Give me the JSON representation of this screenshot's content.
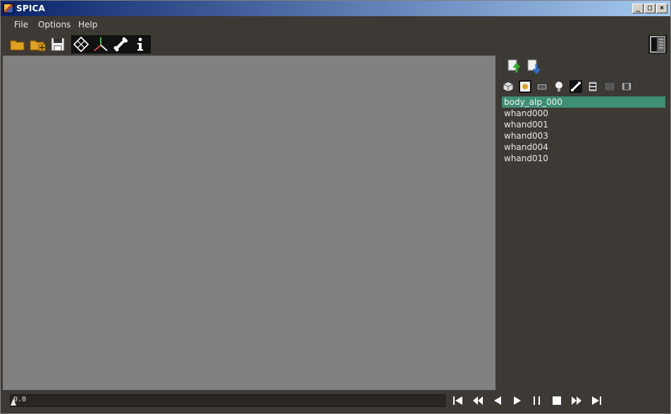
{
  "window": {
    "title": "SPICA"
  },
  "menu": {
    "file": "File",
    "options": "Options",
    "help": "Help"
  },
  "toolbar": {
    "icons": [
      "open-folder-icon",
      "import-folder-icon",
      "save-icon",
      "grid-icon",
      "axis-icon",
      "bone-icon",
      "info-icon",
      "panel-toggle-icon"
    ]
  },
  "sidepanel": {
    "tabs": [
      "model-icon",
      "texture-icon",
      "camera-icon",
      "light-icon",
      "skeleton-icon",
      "material-anim-icon",
      "film-disabled-icon",
      "film-icon"
    ],
    "items": [
      {
        "label": "body_alp_000",
        "selected": true
      },
      {
        "label": "whand000",
        "selected": false
      },
      {
        "label": "whand001",
        "selected": false
      },
      {
        "label": "whand003",
        "selected": false
      },
      {
        "label": "whand004",
        "selected": false
      },
      {
        "label": "whand010",
        "selected": false
      }
    ]
  },
  "playback": {
    "time": "0.0",
    "controls": [
      "skip-to-start",
      "rewind",
      "step-back",
      "play",
      "pause",
      "stop",
      "fast-forward",
      "skip-to-end"
    ]
  },
  "colors": {
    "accent": "#3f8f75",
    "background": "#3d3935",
    "viewport": "#808080"
  }
}
